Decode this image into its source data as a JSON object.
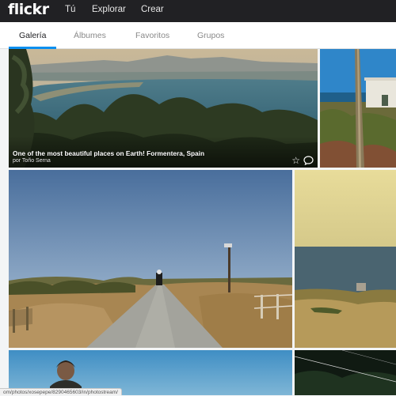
{
  "header": {
    "logo": "flickr",
    "nav": [
      "Tú",
      "Explorar",
      "Crear"
    ]
  },
  "tabs": [
    {
      "label": "Galería",
      "active": true
    },
    {
      "label": "Álbumes",
      "active": false
    },
    {
      "label": "Favoritos",
      "active": false
    },
    {
      "label": "Grupos",
      "active": false
    }
  ],
  "photos": [
    {
      "title": "One of the most beautiful places on Earth! Formentera, Spain",
      "author": "por Toño Serna"
    }
  ],
  "status": {
    "url": "om/photos/xosepepe/8290465603/in/photostream/"
  },
  "colors": {
    "topbar": "#212124",
    "accent": "#0a8ff0"
  },
  "icons": [
    "star-icon",
    "comment-icon"
  ]
}
